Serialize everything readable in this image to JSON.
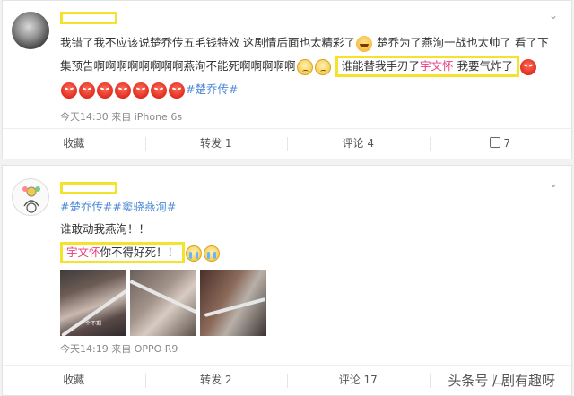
{
  "posts": [
    {
      "text_main": "我错了我不应该说楚乔传五毛钱特效 这剧情后面也太精彩了",
      "text_part2": "楚乔为了燕洵一战也太帅了 看了下集预告啊啊啊啊啊啊啊啊燕洵不能死啊啊啊啊啊",
      "highlight_prefix": "谁能替我手刃了",
      "highlight_name": "宇文怀",
      "highlight_suffix": " 我要气炸了",
      "topic": "#楚乔传#",
      "meta": "今天14:30 来自 iPhone 6s",
      "actions": {
        "collect": "收藏",
        "repost": "转发 1",
        "comment": "评论 4",
        "like": "7"
      }
    },
    {
      "topics": "#楚乔传##窦骁燕洵#",
      "line1": "谁敢动我燕洵！！",
      "line2_name": "宇文怀",
      "line2_rest": "你不得好死！！",
      "image_caption": "一个不剩",
      "meta": "今天14:19 来自 OPPO R9",
      "actions": {
        "collect": "收藏",
        "repost": "转发 2",
        "comment": "评论 17"
      }
    }
  ],
  "watermark": "头条号 / 剧有趣呀",
  "colors": {
    "highlight_box": "#f5e22b",
    "name_pink": "#eb3b7a",
    "topic_blue": "#4d89d6"
  },
  "icons": {
    "more": "chevron-down-icon",
    "like": "like-icon"
  }
}
